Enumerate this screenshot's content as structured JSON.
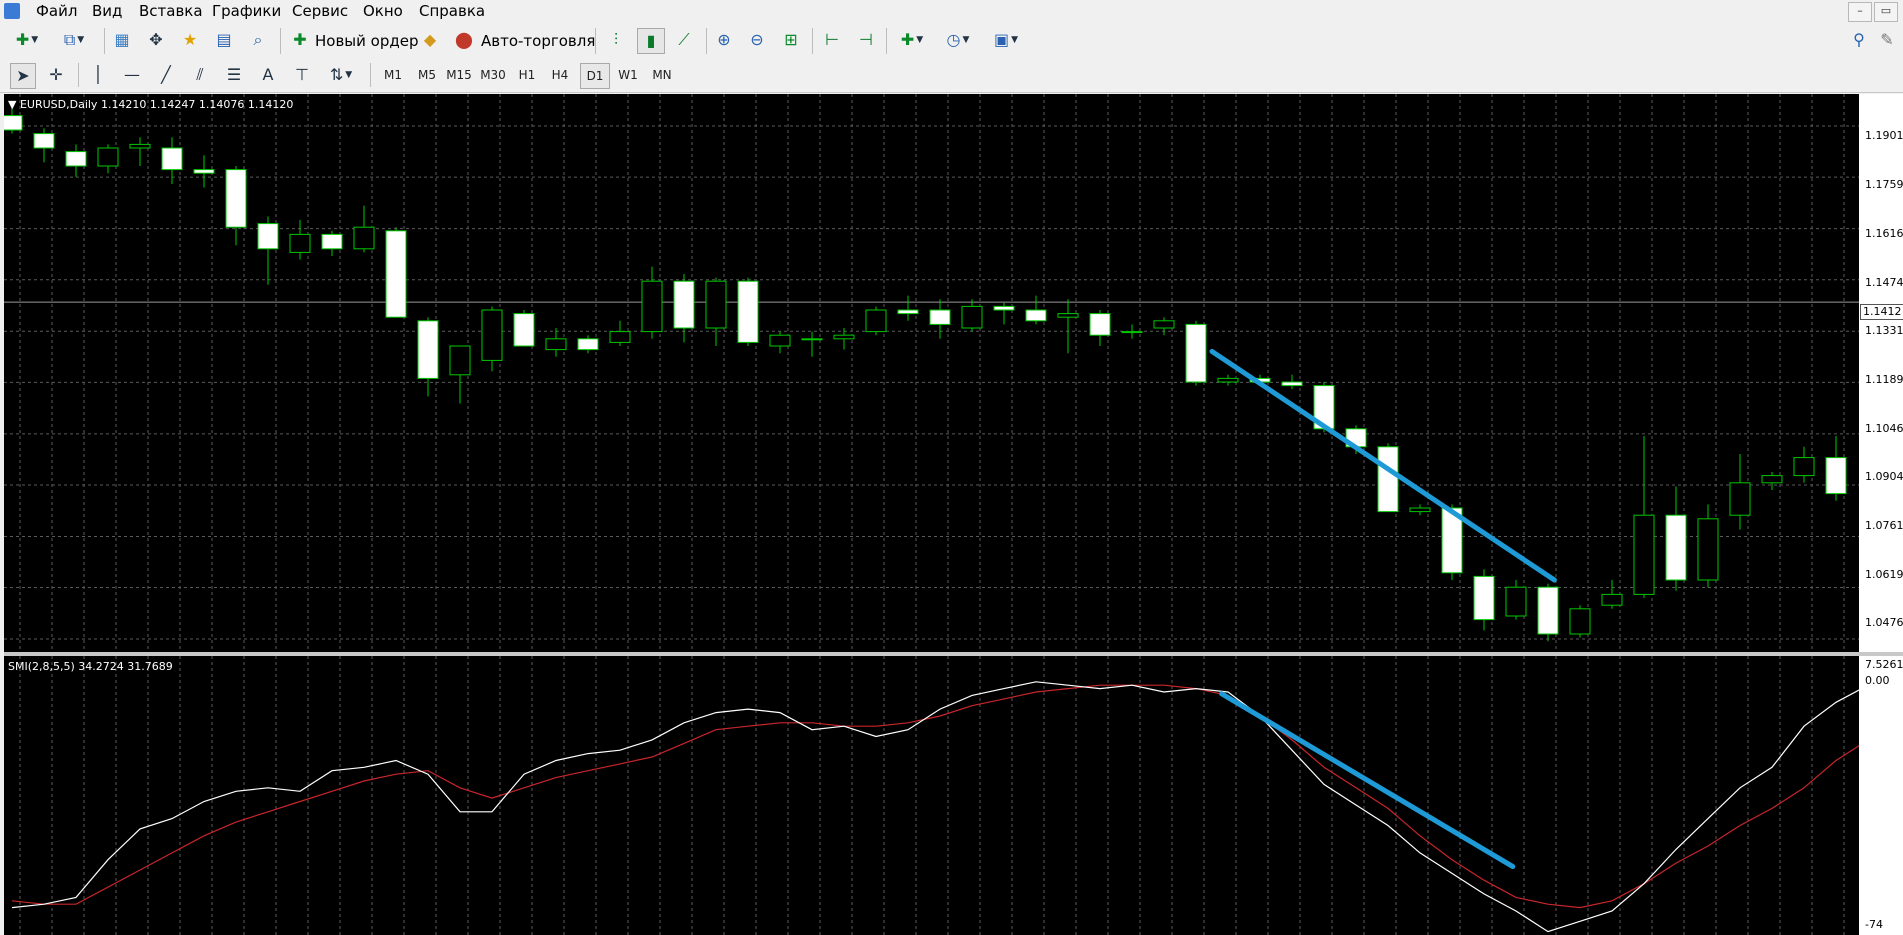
{
  "menu": {
    "items": [
      "Файл",
      "Вид",
      "Вставка",
      "Графики",
      "Сервис",
      "Окно",
      "Справка"
    ]
  },
  "window_controls": {
    "minimize": "–",
    "restore": "▭",
    "close": "✕"
  },
  "toolbar": {
    "new_order_label": "Новый ордер",
    "autotrading_label": "Авто-торговля",
    "icons": [
      "new-chart-icon",
      "profiles-icon",
      "market-watch-icon",
      "navigator-icon",
      "favorites-icon",
      "terminal-icon",
      "strategy-tester-icon",
      "new-order-icon",
      "metaeditor-icon",
      "autotrading-icon",
      "bar-chart-icon",
      "candlestick-icon",
      "line-chart-icon",
      "zoom-in-icon",
      "zoom-out-icon",
      "tile-windows-icon",
      "chart-shift-icon",
      "autoscroll-icon",
      "indicators-icon",
      "periods-icon",
      "templates-icon",
      "search-icon",
      "chat-icon"
    ]
  },
  "timeframes": {
    "items": [
      "M1",
      "M5",
      "M15",
      "M30",
      "H1",
      "H4",
      "D1",
      "W1",
      "MN"
    ],
    "active": "D1"
  },
  "chart": {
    "header": "EURUSD,Daily  1.14210 1.14247 1.14076 1.14120",
    "current_price": "1.1412",
    "price_labels": [
      "1.1901",
      "1.1759",
      "1.1616",
      "1.1474",
      "1.1331",
      "1.1189",
      "1.1046",
      "1.0904",
      "1.0761",
      "1.0619",
      "1.0476"
    ],
    "colors": {
      "background": "#000000",
      "grid": "#5a5a5a",
      "bull_outline": "#00c800",
      "bear_body": "#ffffff",
      "trendline": "#1e9bd7"
    }
  },
  "indicator": {
    "header": "SMI(2,8,5,5) 34.2724 31.7689",
    "axis_labels": [
      "7.5261",
      "0.00",
      "-74"
    ],
    "colors": {
      "smi": "#ffffff",
      "signal": "#c8262b"
    }
  },
  "chart_data": {
    "type": "candlestick",
    "symbol": "EURUSD",
    "timeframe": "Daily",
    "ylim": [
      1.044,
      1.199
    ],
    "candles": [
      {
        "o": 1.193,
        "h": 1.196,
        "l": 1.188,
        "c": 1.189
      },
      {
        "o": 1.188,
        "h": 1.1895,
        "l": 1.18,
        "c": 1.184
      },
      {
        "o": 1.183,
        "h": 1.185,
        "l": 1.176,
        "c": 1.179
      },
      {
        "o": 1.179,
        "h": 1.185,
        "l": 1.177,
        "c": 1.184
      },
      {
        "o": 1.184,
        "h": 1.187,
        "l": 1.179,
        "c": 1.185
      },
      {
        "o": 1.184,
        "h": 1.187,
        "l": 1.174,
        "c": 1.178
      },
      {
        "o": 1.178,
        "h": 1.182,
        "l": 1.173,
        "c": 1.177
      },
      {
        "o": 1.178,
        "h": 1.179,
        "l": 1.157,
        "c": 1.162
      },
      {
        "o": 1.163,
        "h": 1.165,
        "l": 1.146,
        "c": 1.156
      },
      {
        "o": 1.155,
        "h": 1.164,
        "l": 1.153,
        "c": 1.16
      },
      {
        "o": 1.16,
        "h": 1.161,
        "l": 1.154,
        "c": 1.156
      },
      {
        "o": 1.156,
        "h": 1.168,
        "l": 1.155,
        "c": 1.162
      },
      {
        "o": 1.161,
        "h": 1.162,
        "l": 1.138,
        "c": 1.137
      },
      {
        "o": 1.136,
        "h": 1.137,
        "l": 1.115,
        "c": 1.12
      },
      {
        "o": 1.121,
        "h": 1.129,
        "l": 1.113,
        "c": 1.129
      },
      {
        "o": 1.125,
        "h": 1.14,
        "l": 1.122,
        "c": 1.139
      },
      {
        "o": 1.138,
        "h": 1.139,
        "l": 1.129,
        "c": 1.129
      },
      {
        "o": 1.128,
        "h": 1.134,
        "l": 1.126,
        "c": 1.131
      },
      {
        "o": 1.131,
        "h": 1.132,
        "l": 1.127,
        "c": 1.128
      },
      {
        "o": 1.13,
        "h": 1.136,
        "l": 1.129,
        "c": 1.133
      },
      {
        "o": 1.133,
        "h": 1.151,
        "l": 1.131,
        "c": 1.147
      },
      {
        "o": 1.147,
        "h": 1.149,
        "l": 1.13,
        "c": 1.134
      },
      {
        "o": 1.134,
        "h": 1.148,
        "l": 1.129,
        "c": 1.147
      },
      {
        "o": 1.147,
        "h": 1.148,
        "l": 1.129,
        "c": 1.13
      },
      {
        "o": 1.129,
        "h": 1.133,
        "l": 1.127,
        "c": 1.132
      },
      {
        "o": 1.131,
        "h": 1.133,
        "l": 1.126,
        "c": 1.131
      },
      {
        "o": 1.131,
        "h": 1.134,
        "l": 1.128,
        "c": 1.132
      },
      {
        "o": 1.133,
        "h": 1.14,
        "l": 1.132,
        "c": 1.139
      },
      {
        "o": 1.139,
        "h": 1.143,
        "l": 1.136,
        "c": 1.138
      },
      {
        "o": 1.139,
        "h": 1.142,
        "l": 1.131,
        "c": 1.135
      },
      {
        "o": 1.134,
        "h": 1.142,
        "l": 1.133,
        "c": 1.14
      },
      {
        "o": 1.14,
        "h": 1.141,
        "l": 1.135,
        "c": 1.139
      },
      {
        "o": 1.139,
        "h": 1.143,
        "l": 1.135,
        "c": 1.136
      },
      {
        "o": 1.137,
        "h": 1.142,
        "l": 1.127,
        "c": 1.138
      },
      {
        "o": 1.138,
        "h": 1.139,
        "l": 1.129,
        "c": 1.132
      },
      {
        "o": 1.133,
        "h": 1.135,
        "l": 1.131,
        "c": 1.133
      },
      {
        "o": 1.134,
        "h": 1.137,
        "l": 1.132,
        "c": 1.136
      },
      {
        "o": 1.135,
        "h": 1.136,
        "l": 1.118,
        "c": 1.119
      },
      {
        "o": 1.119,
        "h": 1.121,
        "l": 1.118,
        "c": 1.12
      },
      {
        "o": 1.12,
        "h": 1.121,
        "l": 1.118,
        "c": 1.119
      },
      {
        "o": 1.119,
        "h": 1.121,
        "l": 1.117,
        "c": 1.118
      },
      {
        "o": 1.118,
        "h": 1.119,
        "l": 1.105,
        "c": 1.106
      },
      {
        "o": 1.106,
        "h": 1.107,
        "l": 1.099,
        "c": 1.101
      },
      {
        "o": 1.101,
        "h": 1.102,
        "l": 1.083,
        "c": 1.083
      },
      {
        "o": 1.083,
        "h": 1.085,
        "l": 1.082,
        "c": 1.084
      },
      {
        "o": 1.084,
        "h": 1.085,
        "l": 1.064,
        "c": 1.066
      },
      {
        "o": 1.065,
        "h": 1.067,
        "l": 1.05,
        "c": 1.053
      },
      {
        "o": 1.054,
        "h": 1.064,
        "l": 1.053,
        "c": 1.062
      },
      {
        "o": 1.062,
        "h": 1.063,
        "l": 1.047,
        "c": 1.049
      },
      {
        "o": 1.049,
        "h": 1.057,
        "l": 1.048,
        "c": 1.056
      },
      {
        "o": 1.057,
        "h": 1.064,
        "l": 1.056,
        "c": 1.06
      },
      {
        "o": 1.06,
        "h": 1.104,
        "l": 1.059,
        "c": 1.082
      },
      {
        "o": 1.082,
        "h": 1.09,
        "l": 1.061,
        "c": 1.064
      },
      {
        "o": 1.064,
        "h": 1.085,
        "l": 1.062,
        "c": 1.081
      },
      {
        "o": 1.082,
        "h": 1.099,
        "l": 1.078,
        "c": 1.091
      },
      {
        "o": 1.091,
        "h": 1.094,
        "l": 1.089,
        "c": 1.093
      },
      {
        "o": 1.093,
        "h": 1.101,
        "l": 1.091,
        "c": 1.098
      },
      {
        "o": 1.098,
        "h": 1.104,
        "l": 1.086,
        "c": 1.088
      }
    ],
    "trendlines": [
      {
        "from": {
          "bar": 37.5,
          "price": 1.1275
        },
        "to": {
          "bar": 48.2,
          "price": 1.064
        }
      }
    ],
    "indicator": {
      "name": "SMI(2,8,5,5)",
      "ylim": [
        -74,
        7.5261
      ],
      "smi": [
        -66,
        -65,
        -63,
        -52,
        -43,
        -40,
        -35,
        -32,
        -31,
        -32,
        -26,
        -25,
        -23,
        -27,
        -38,
        -38,
        -27,
        -23,
        -21,
        -20,
        -17,
        -12,
        -9,
        -8,
        -9,
        -14,
        -13,
        -16,
        -14,
        -8,
        -4,
        -2,
        0,
        -1,
        -2,
        -1,
        -3,
        -2,
        -3,
        -10,
        -20,
        -30,
        -36,
        -42,
        -50,
        -56,
        -62,
        -67,
        -73,
        -70,
        -67,
        -59,
        -49,
        -40,
        -31,
        -25,
        -13,
        -6,
        -1,
        -2
      ],
      "signal": [
        -64,
        -65,
        -65,
        -60,
        -55,
        -50,
        -45,
        -41,
        -38,
        -35,
        -32,
        -29,
        -27,
        -26,
        -31,
        -34,
        -31,
        -28,
        -26,
        -24,
        -22,
        -18,
        -14,
        -13,
        -12,
        -12,
        -13,
        -13,
        -12,
        -10,
        -7,
        -5,
        -3,
        -2,
        -1,
        -1,
        -1,
        -2,
        -4,
        -10,
        -17,
        -25,
        -31,
        -37,
        -45,
        -52,
        -58,
        -63,
        -65,
        -66,
        -64,
        -59,
        -53,
        -48,
        -42,
        -37,
        -31,
        -23,
        -17,
        -12
      ],
      "trendlines": [
        {
          "from": {
            "bar": 37.8,
            "price": -3.5
          },
          "to": {
            "bar": 46.9,
            "price": -54
          }
        }
      ]
    }
  }
}
